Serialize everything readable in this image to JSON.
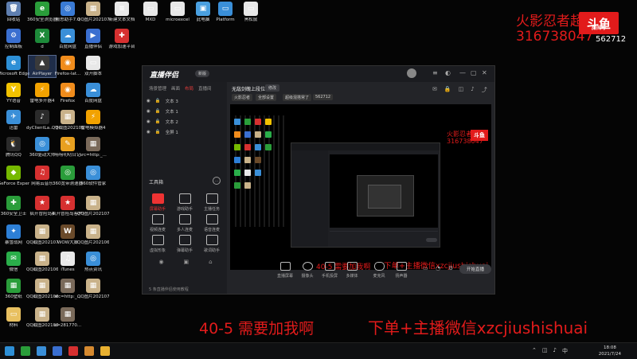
{
  "desktop_icons": [
    {
      "label": "回收站",
      "color": "#5f7fb0",
      "glyph": "🗑"
    },
    {
      "label": "360安全浏览器",
      "color": "#2a9d3a",
      "glyph": "e"
    },
    {
      "label": "搬思助手7.0",
      "color": "#3a7bd5",
      "glyph": "◎"
    },
    {
      "label": "QQ图片20210719...",
      "color": "#c9b28a",
      "glyph": "▦"
    },
    {
      "label": "新建文本文档",
      "color": "#e8e8e8",
      "glyph": "≡"
    },
    {
      "label": "MXD",
      "color": "#e8e8e8",
      "glyph": "▭"
    },
    {
      "label": "microexcel",
      "color": "#e8e8e8",
      "glyph": "▭"
    },
    {
      "label": "此电脑",
      "color": "#4aa0e0",
      "glyph": "▣"
    },
    {
      "label": "Platform",
      "color": "#3a8fd8",
      "glyph": "▭"
    },
    {
      "label": "黑松鼠",
      "color": "#e8e8e8",
      "glyph": "▭"
    },
    {
      "label": "控制面板",
      "color": "#3a6fd0",
      "glyph": "⚙"
    },
    {
      "label": "d",
      "color": "#1d8a3a",
      "glyph": "X"
    },
    {
      "label": "百度网盘",
      "color": "#3a8fd8",
      "glyph": "☁"
    },
    {
      "label": "直播伴侣",
      "color": "#3a6fd0",
      "glyph": "▶"
    },
    {
      "label": "游戏加速平台",
      "color": "#d63030",
      "glyph": "✚"
    },
    {
      "label": "Microsoft Edge",
      "color": "#2d8fd6",
      "glyph": "e"
    },
    {
      "label": "AirPlayer",
      "color": "#3a3a3a",
      "glyph": "▲"
    },
    {
      "label": "Firefox-lat...",
      "color": "#f08c1c",
      "glyph": "◉"
    },
    {
      "label": "双开脚本",
      "color": "#e8e8e8",
      "glyph": "▭"
    },
    {
      "label": "YY语音",
      "color": "#f2c200",
      "glyph": "Y"
    },
    {
      "label": "雷电多开器4",
      "color": "#f2a200",
      "glyph": "⚡"
    },
    {
      "label": "Firefox",
      "color": "#f08c1c",
      "glyph": "◉"
    },
    {
      "label": "百度网盘",
      "color": "#3a8fd8",
      "glyph": "☁"
    },
    {
      "label": "迅雷",
      "color": "#3a8fd8",
      "glyph": "✈"
    },
    {
      "label": "dyClientLa... 快捷方式",
      "color": "#2b2b2b",
      "glyph": "♪"
    },
    {
      "label": "QQ截图20210605...",
      "color": "#c9b28a",
      "glyph": "▦"
    },
    {
      "label": "雷电模拟器4",
      "color": "#f2a200",
      "glyph": "⚡"
    },
    {
      "label": "腾讯QQ",
      "color": "#2b2b2b",
      "glyph": "🐧"
    },
    {
      "label": "360驱动大师",
      "color": "#3a8fd8",
      "glyph": "◎"
    },
    {
      "label": "唠唠叨叨日记",
      "color": "#e8a020",
      "glyph": "✎"
    },
    {
      "label": "src=http:_...",
      "color": "#7a6a5a",
      "glyph": "▦"
    },
    {
      "label": "GeForce Experience",
      "color": "#76b900",
      "glyph": "◆"
    },
    {
      "label": "网易云音乐",
      "color": "#d63030",
      "glyph": "♫"
    },
    {
      "label": "360宽带测速器",
      "color": "#2a9d3a",
      "glyph": "◎"
    },
    {
      "label": "360软件管家",
      "color": "#3a8fd8",
      "glyph": "◎"
    },
    {
      "label": "360安全卫士",
      "color": "#2a9d3a",
      "glyph": "✚"
    },
    {
      "label": "疯开冒险岛4",
      "color": "#d63030",
      "glyph": "★"
    },
    {
      "label": "疯开冒险岛客户端下载器",
      "color": "#d63030",
      "glyph": "★"
    },
    {
      "label": "QQ图片20210719...",
      "color": "#c9b28a",
      "glyph": "▦"
    },
    {
      "label": "暴雪战网",
      "color": "#2d7fd6",
      "glyph": "✦"
    },
    {
      "label": "QQ截图20210704...",
      "color": "#c9b28a",
      "glyph": "▦"
    },
    {
      "label": "WOW大脚",
      "color": "#6a4a2a",
      "glyph": "W"
    },
    {
      "label": "QQ图片20210605...",
      "color": "#c9b28a",
      "glyph": "▦"
    },
    {
      "label": "微信",
      "color": "#2aae4a",
      "glyph": "✉"
    },
    {
      "label": "QQ截图20210605...",
      "color": "#c9b28a",
      "glyph": "▦"
    },
    {
      "label": "iTunes",
      "color": "#e8e8e8",
      "glyph": "♫"
    },
    {
      "label": "热点资讯",
      "color": "#3a8fd8",
      "glyph": "◎"
    },
    {
      "label": "360壁纸",
      "color": "#2a9d3a",
      "glyph": "▦"
    },
    {
      "label": "QQ截图20210605...",
      "color": "#c9b28a",
      "glyph": "▦"
    },
    {
      "label": "src=http:_...",
      "color": "#7a6a5a",
      "glyph": "▦"
    },
    {
      "label": "QQ图片20210722...",
      "color": "#c9b28a",
      "glyph": "▦"
    },
    {
      "label": "材料",
      "color": "#e8c060",
      "glyph": "▭"
    },
    {
      "label": "QQ截图20210605...",
      "color": "#c9b28a",
      "glyph": "▦"
    },
    {
      "label": "u=281770...",
      "color": "#7a6a5a",
      "glyph": "▦"
    }
  ],
  "overlay": {
    "top_name": "火影忍者超",
    "top_id": "316738047",
    "logo_text": "斗鱼",
    "logo_sub": "房间号",
    "room_number": "562712",
    "inner_msg": "40-5 需要加我啊",
    "inner_contact": "下单+主播微信xzcjiushishuai",
    "bottom_msg": "40-5 需要加我啊",
    "bottom_contact": "下单+主播微信xzcjiushishuai"
  },
  "window": {
    "brand": "直播伴侣",
    "badge": "新版",
    "tabs": [
      "场景管理",
      "画面",
      "布局",
      "直播间"
    ],
    "scenes": [
      "文本 3",
      "文本 1",
      "文本 2",
      "全屏 1"
    ],
    "tools_title": "工具箱",
    "tools": [
      "屏幕助手",
      "游戏助手",
      "主播任务",
      "视频连麦",
      "多人连麦",
      "语音连麦",
      "虚拟形象",
      "弹幕助手",
      "歌词助手"
    ],
    "main_title": "无敌剑魄上段位",
    "main_tag": "修改",
    "chips": [
      "火影忍者",
      "全部设置",
      "超级混搭常了",
      "562712"
    ],
    "bottom_tools": [
      "直播屏幕",
      "摄像头",
      "手机投屏",
      "多媒体",
      "麦克风",
      "扬声器"
    ],
    "start_label": "开始直播",
    "status_line": "5 条直播伴侣使用教程"
  },
  "taskbar": {
    "time": "18:08",
    "date": "2021/7/24",
    "ime": "中"
  },
  "colors": {
    "accent": "#e21b1b"
  }
}
